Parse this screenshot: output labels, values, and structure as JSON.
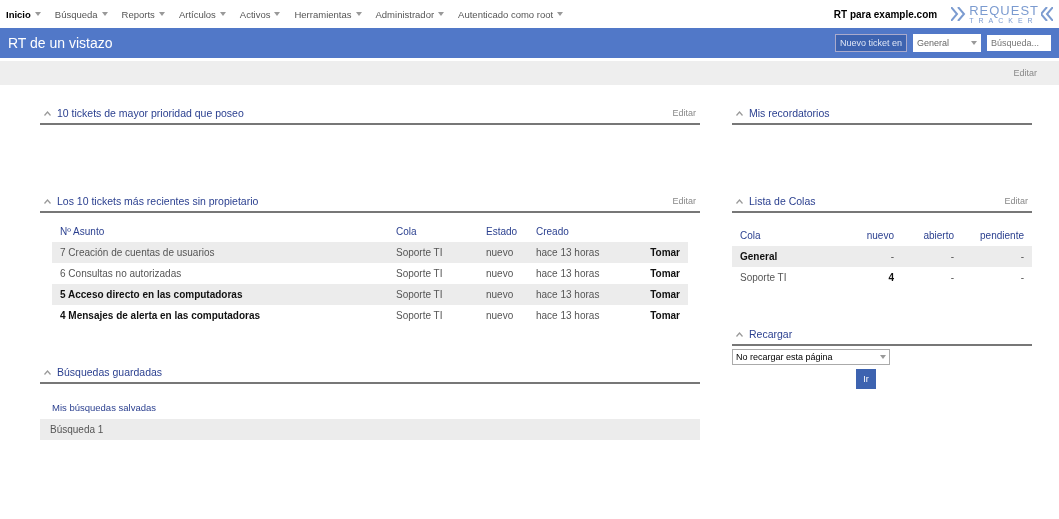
{
  "menu": [
    {
      "label": "Inicio",
      "selected": true
    },
    {
      "label": "Búsqueda",
      "selected": false
    },
    {
      "label": "Reports",
      "selected": false
    },
    {
      "label": "Artículos",
      "selected": false
    },
    {
      "label": "Activos",
      "selected": false
    },
    {
      "label": "Herramientas",
      "selected": false
    },
    {
      "label": "Administrador",
      "selected": false
    },
    {
      "label": "Autenticado como root",
      "selected": false
    }
  ],
  "site": "RT para example.com",
  "logo": {
    "top": "REQUEST",
    "bottom": "TRACKER"
  },
  "header": {
    "title": "RT de un vistazo",
    "new_ticket": "Nuevo ticket en",
    "queue": "General",
    "search_placeholder": "Búsqueda..."
  },
  "edit_link": "Editar",
  "left": [
    {
      "kind": "empty",
      "title": "10 tickets de mayor prioridad que poseo",
      "edit": "Editar"
    },
    {
      "kind": "tickets",
      "title": "Los 10 tickets más recientes sin propietario",
      "edit": "Editar",
      "columns": [
        "Nº Asunto",
        "Cola",
        "Estado",
        "Creado"
      ],
      "rows": [
        {
          "id": "7",
          "subject": "Creación de cuentas de usuarios",
          "queue": "Soporte TI",
          "status": "nuevo",
          "created": "hace 13 horas",
          "action": "Tomar",
          "bold": false
        },
        {
          "id": "6",
          "subject": "Consultas no autorizadas",
          "queue": "Soporte TI",
          "status": "nuevo",
          "created": "hace 13 horas",
          "action": "Tomar",
          "bold": false
        },
        {
          "id": "5",
          "subject": "Acceso directo en las computadoras",
          "queue": "Soporte TI",
          "status": "nuevo",
          "created": "hace 13 horas",
          "action": "Tomar",
          "bold": true
        },
        {
          "id": "4",
          "subject": "Mensajes de alerta en las computadoras",
          "queue": "Soporte TI",
          "status": "nuevo",
          "created": "hace 13 horas",
          "action": "Tomar",
          "bold": true
        }
      ]
    },
    {
      "kind": "searches",
      "title": "Búsquedas guardadas",
      "subtitle": "Mis búsquedas salvadas",
      "items": [
        "Búsqueda 1"
      ]
    }
  ],
  "right": [
    {
      "kind": "empty",
      "title": "Mis recordatorios"
    },
    {
      "kind": "queues",
      "title": "Lista de Colas",
      "edit": "Editar",
      "columns": [
        "Cola",
        "nuevo",
        "abierto",
        "pendiente"
      ],
      "rows": [
        {
          "cells": [
            "General",
            "-",
            "-",
            "-"
          ],
          "bold": true
        },
        {
          "cells": [
            "Soporte TI",
            "4",
            "-",
            "-"
          ],
          "bold": false
        }
      ]
    },
    {
      "kind": "reload",
      "title": "Recargar",
      "select": "No recargar esta página",
      "button": "Ir"
    }
  ]
}
